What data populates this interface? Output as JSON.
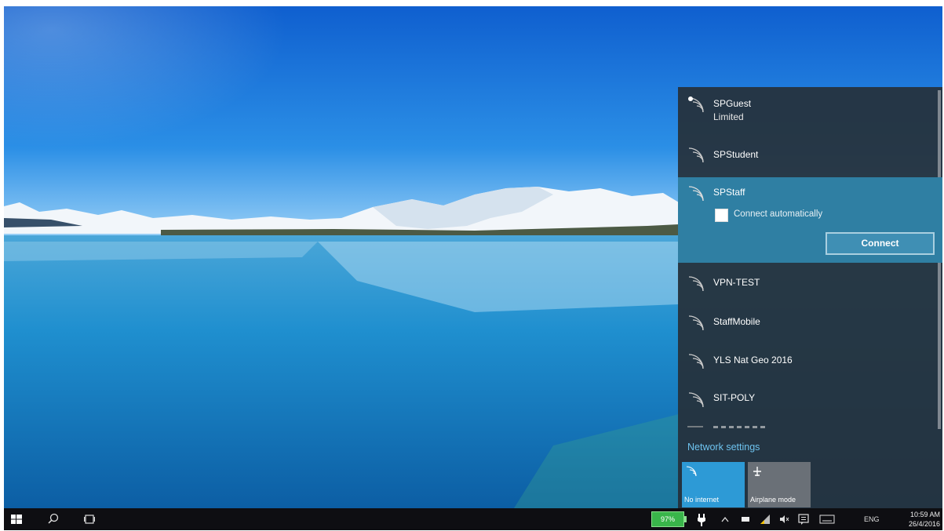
{
  "flyout": {
    "networks": [
      {
        "ssid": "SPGuest",
        "status": "Limited",
        "icon": "wifi-warning-icon"
      },
      {
        "ssid": "SPStudent",
        "icon": "wifi-icon"
      },
      {
        "ssid": "SPStaff",
        "icon": "wifi-icon",
        "connect_auto_label": "Connect automatically",
        "connect_label": "Connect",
        "selected": true
      },
      {
        "ssid": "VPN-TEST",
        "icon": "wifi-icon"
      },
      {
        "ssid": "StaffMobile",
        "icon": "wifi-icon"
      },
      {
        "ssid": "YLS Nat Geo 2016",
        "icon": "wifi-icon"
      },
      {
        "ssid": "SIT-POLY",
        "icon": "wifi-icon"
      }
    ],
    "network_settings": "Network settings",
    "tiles": [
      {
        "label": "No internet",
        "icon": "wifi-icon",
        "active": true
      },
      {
        "label": "Airplane mode",
        "icon": "airplane-icon",
        "active": false
      }
    ]
  },
  "taskbar": {
    "battery_percent": "97%",
    "language": "ENG",
    "time": "10:59 AM",
    "date": "26/4/2016"
  },
  "colors": {
    "flyout_bg": "#26303a",
    "selected_bg": "#2f7fa3",
    "accent_link": "#6ec3ef",
    "tile_active": "#2d9ad6",
    "tile_inactive": "#6a7077",
    "battery": "#39b54a",
    "taskbar": "#0e0e12"
  }
}
